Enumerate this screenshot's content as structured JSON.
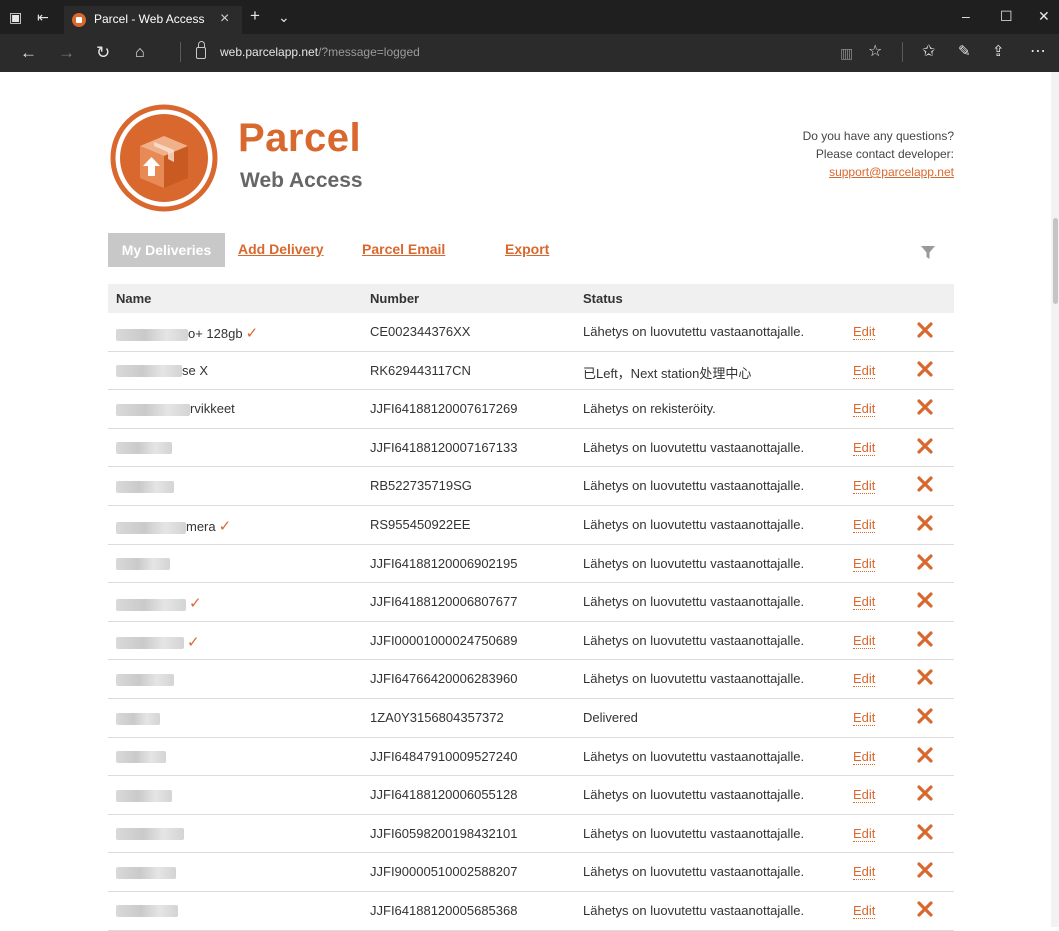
{
  "browser": {
    "tab_title": "Parcel - Web Access",
    "url_host": "web.parcelapp.net",
    "url_path": "/?message=logged"
  },
  "header": {
    "title": "Parcel",
    "subtitle": "Web Access",
    "contact_line1": "Do you have any questions?",
    "contact_line2": "Please contact developer:",
    "contact_email": "support@parcelapp.net"
  },
  "nav": {
    "my_deliveries": "My Deliveries",
    "add_delivery": "Add Delivery",
    "parcel_email": "Parcel Email",
    "export": "Export"
  },
  "table": {
    "headers": {
      "name": "Name",
      "number": "Number",
      "status": "Status"
    },
    "edit_label": "Edit",
    "rows": [
      {
        "name": "o+ 128gb",
        "number": "CE002344376XX",
        "status": "Lähetys on luovutettu vastaanottajalle.",
        "checked": true
      },
      {
        "name": "se X",
        "number": "RK629443117CN",
        "status": "已Left，Next station处理中心",
        "checked": false
      },
      {
        "name": "rvikkeet",
        "number": "JJFI64188120007617269",
        "status": "Lähetys on rekisteröity.",
        "checked": false
      },
      {
        "name": "",
        "number": "JJFI64188120007167133",
        "status": "Lähetys on luovutettu vastaanottajalle.",
        "checked": false
      },
      {
        "name": "",
        "number": "RB522735719SG",
        "status": "Lähetys on luovutettu vastaanottajalle.",
        "checked": false
      },
      {
        "name": "mera",
        "number": "RS955450922EE",
        "status": "Lähetys on luovutettu vastaanottajalle.",
        "checked": true
      },
      {
        "name": "",
        "number": "JJFI64188120006902195",
        "status": "Lähetys on luovutettu vastaanottajalle.",
        "checked": false
      },
      {
        "name": "",
        "number": "JJFI64188120006807677",
        "status": "Lähetys on luovutettu vastaanottajalle.",
        "checked": true
      },
      {
        "name": "",
        "number": "JJFI00001000024750689",
        "status": "Lähetys on luovutettu vastaanottajalle.",
        "checked": true
      },
      {
        "name": "",
        "number": "JJFI64766420006283960",
        "status": "Lähetys on luovutettu vastaanottajalle.",
        "checked": false
      },
      {
        "name": "",
        "number": "1ZA0Y3156804357372",
        "status": "Delivered",
        "checked": false
      },
      {
        "name": "",
        "number": "JJFI64847910009527240",
        "status": "Lähetys on luovutettu vastaanottajalle.",
        "checked": false
      },
      {
        "name": "",
        "number": "JJFI64188120006055128",
        "status": "Lähetys on luovutettu vastaanottajalle.",
        "checked": false
      },
      {
        "name": "",
        "number": "JJFI60598200198432101",
        "status": "Lähetys on luovutettu vastaanottajalle.",
        "checked": false
      },
      {
        "name": "",
        "number": "JJFI90000510002588207",
        "status": "Lähetys on luovutettu vastaanottajalle.",
        "checked": false
      },
      {
        "name": "",
        "number": "JJFI64188120005685368",
        "status": "Lähetys on luovutettu vastaanottajalle.",
        "checked": false
      }
    ]
  },
  "colors": {
    "accent": "#d9682f",
    "nav_active_bg": "#c8c8c8",
    "header_bg": "#f0f0f0"
  }
}
